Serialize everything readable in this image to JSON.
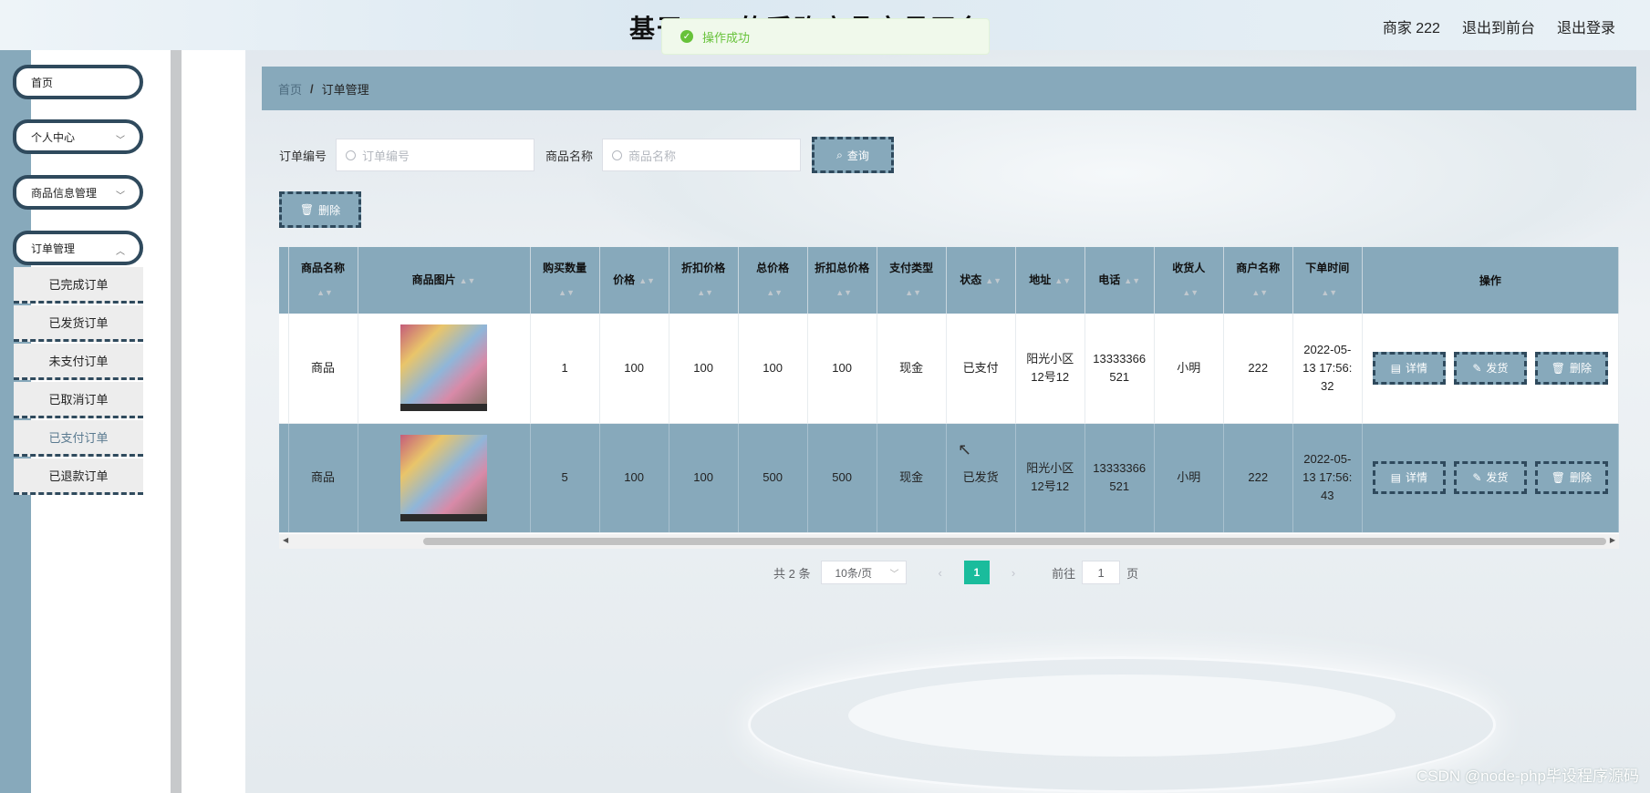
{
  "header": {
    "title": "基于……的采购商品交易平台",
    "user": "商家 222",
    "back_front": "退出到前台",
    "logout": "退出登录"
  },
  "toast": {
    "message": "操作成功"
  },
  "sidebar": {
    "items": [
      {
        "label": "首页"
      },
      {
        "label": "个人中心"
      },
      {
        "label": "商品信息管理"
      },
      {
        "label": "订单管理"
      }
    ],
    "sub_items": [
      {
        "label": "已完成订单"
      },
      {
        "label": "已发货订单"
      },
      {
        "label": "未支付订单"
      },
      {
        "label": "已取消订单"
      },
      {
        "label": "已支付订单"
      },
      {
        "label": "已退款订单"
      }
    ]
  },
  "breadcrumb": {
    "home": "首页",
    "sep": "/",
    "current": "订单管理"
  },
  "search": {
    "order_no_label": "订单编号",
    "order_no_placeholder": "订单编号",
    "product_label": "商品名称",
    "product_placeholder": "商品名称",
    "query_button": "查询",
    "delete_button": "删除"
  },
  "table": {
    "headers": [
      "商品名称",
      "商品图片",
      "购买数量",
      "价格",
      "折扣价格",
      "总价格",
      "折扣总价格",
      "支付类型",
      "状态",
      "地址",
      "电话",
      "收货人",
      "商户名称",
      "下单时间",
      "操作"
    ],
    "rows": [
      {
        "name": "商品",
        "qty": "1",
        "price": "100",
        "disc_price": "100",
        "total": "100",
        "disc_total": "100",
        "pay": "现金",
        "status": "已支付",
        "address": "阳光小区12号12",
        "phone": "13333366521",
        "receiver": "小明",
        "merchant": "222",
        "time": "2022-05-13 17:56:32"
      },
      {
        "name": "商品",
        "qty": "5",
        "price": "100",
        "disc_price": "100",
        "total": "500",
        "disc_total": "500",
        "pay": "现金",
        "status": "已发货",
        "address": "阳光小区12号12",
        "phone": "13333366521",
        "receiver": "小明",
        "merchant": "222",
        "time": "2022-05-13 17:56:43"
      }
    ],
    "actions": {
      "detail": "详情",
      "ship": "发货",
      "delete": "删除"
    }
  },
  "pager": {
    "total": "共 2 条",
    "page_size": "10条/页",
    "current_page": "1",
    "goto": "前往",
    "goto_value": "1",
    "page_unit": "页"
  },
  "watermark": "CSDN @node-php毕设程序源码"
}
